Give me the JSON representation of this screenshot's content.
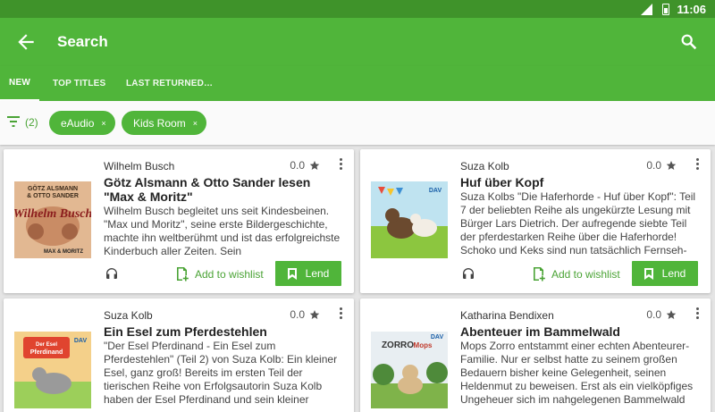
{
  "statusbar": {
    "network": "4G",
    "time": "11:06"
  },
  "appbar": {
    "title": "Search"
  },
  "tabs": [
    {
      "label": "NEW",
      "selected": true
    },
    {
      "label": "TOP TITLES",
      "selected": false
    },
    {
      "label": "LAST RETURNED…",
      "selected": false
    }
  ],
  "filters": {
    "count_label": "(2)",
    "chips": [
      {
        "label": "eAudio",
        "remove": "×"
      },
      {
        "label": "Kids Room",
        "remove": "×"
      }
    ]
  },
  "cards": [
    {
      "author": "Wilhelm Busch",
      "rating": "0.0",
      "title": "Götz Alsmann & Otto Sander lesen \"Max & Moritz\"",
      "description": "Wilhelm Busch begleitet uns seit Kindesbeinen. \"Max und Moritz\", seine erste Bildergeschichte, machte ihn weltberühmt und ist das erfolgreichste Kinderbuch aller Zeiten. Sein",
      "wishlist_label": "Add to wishlist",
      "lend_label": "Lend",
      "cover_text": [
        "GÖTZ ALSMANN",
        "& OTTO SANDER",
        "Wilhelm Busch",
        "MAX & MORITZ"
      ]
    },
    {
      "author": "Suza Kolb",
      "rating": "0.0",
      "title": "Huf über Kopf",
      "description": "Suza Kolbs \"Die Haferhorde - Huf über Kopf\": Teil 7 der beliebten Reihe als ungekürzte Lesung mit Bürger Lars Dietrich. Der aufregende siebte Teil der pferdestarken Reihe über die Haferhorde! Schoko und Keks sind nun tatsächlich Fernseh-St…",
      "wishlist_label": "Add to wishlist",
      "lend_label": "Lend",
      "cover_text": [
        "DAV"
      ]
    },
    {
      "author": "Suza Kolb",
      "rating": "0.0",
      "title": "Ein Esel zum Pferdestehlen",
      "description": "\"Der Esel Pferdinand - Ein Esel zum Pferdestehlen\" (Teil 2) von Suza Kolb: Ein kleiner Esel, ganz groß! Bereits im ersten Teil der tierischen Reihe von Erfolgsautorin Suza Kolb haben der Esel Pferdinand und sein kleiner Freund…",
      "cover_text": [
        "Der Esel",
        "Pferdinand",
        "DAV"
      ]
    },
    {
      "author": "Katharina Bendixen",
      "rating": "0.0",
      "title": "Abenteuer im Bammelwald",
      "description": "Mops Zorro entstammt einer echten Abenteurer-Familie. Nur er selbst hatte zu seinem großen Bedauern bisher keine Gelegenheit, seinen Heldenmut zu beweisen. Erst als ein vielköpfiges Ungeheuer sich im nahgelegenen Bammelwald ei…",
      "cover_text": [
        "ZORRO",
        "Mops",
        "DAV"
      ]
    }
  ],
  "colors": {
    "brand": "#50b53a",
    "statusbar": "#3f932a",
    "accent_text": "#4aa335"
  },
  "icons": [
    "back-arrow-icon",
    "search-icon",
    "filter-icon",
    "close-icon",
    "star-icon",
    "more-vert-icon",
    "headset-icon",
    "wishlist-add-icon",
    "bookmark-icon"
  ]
}
